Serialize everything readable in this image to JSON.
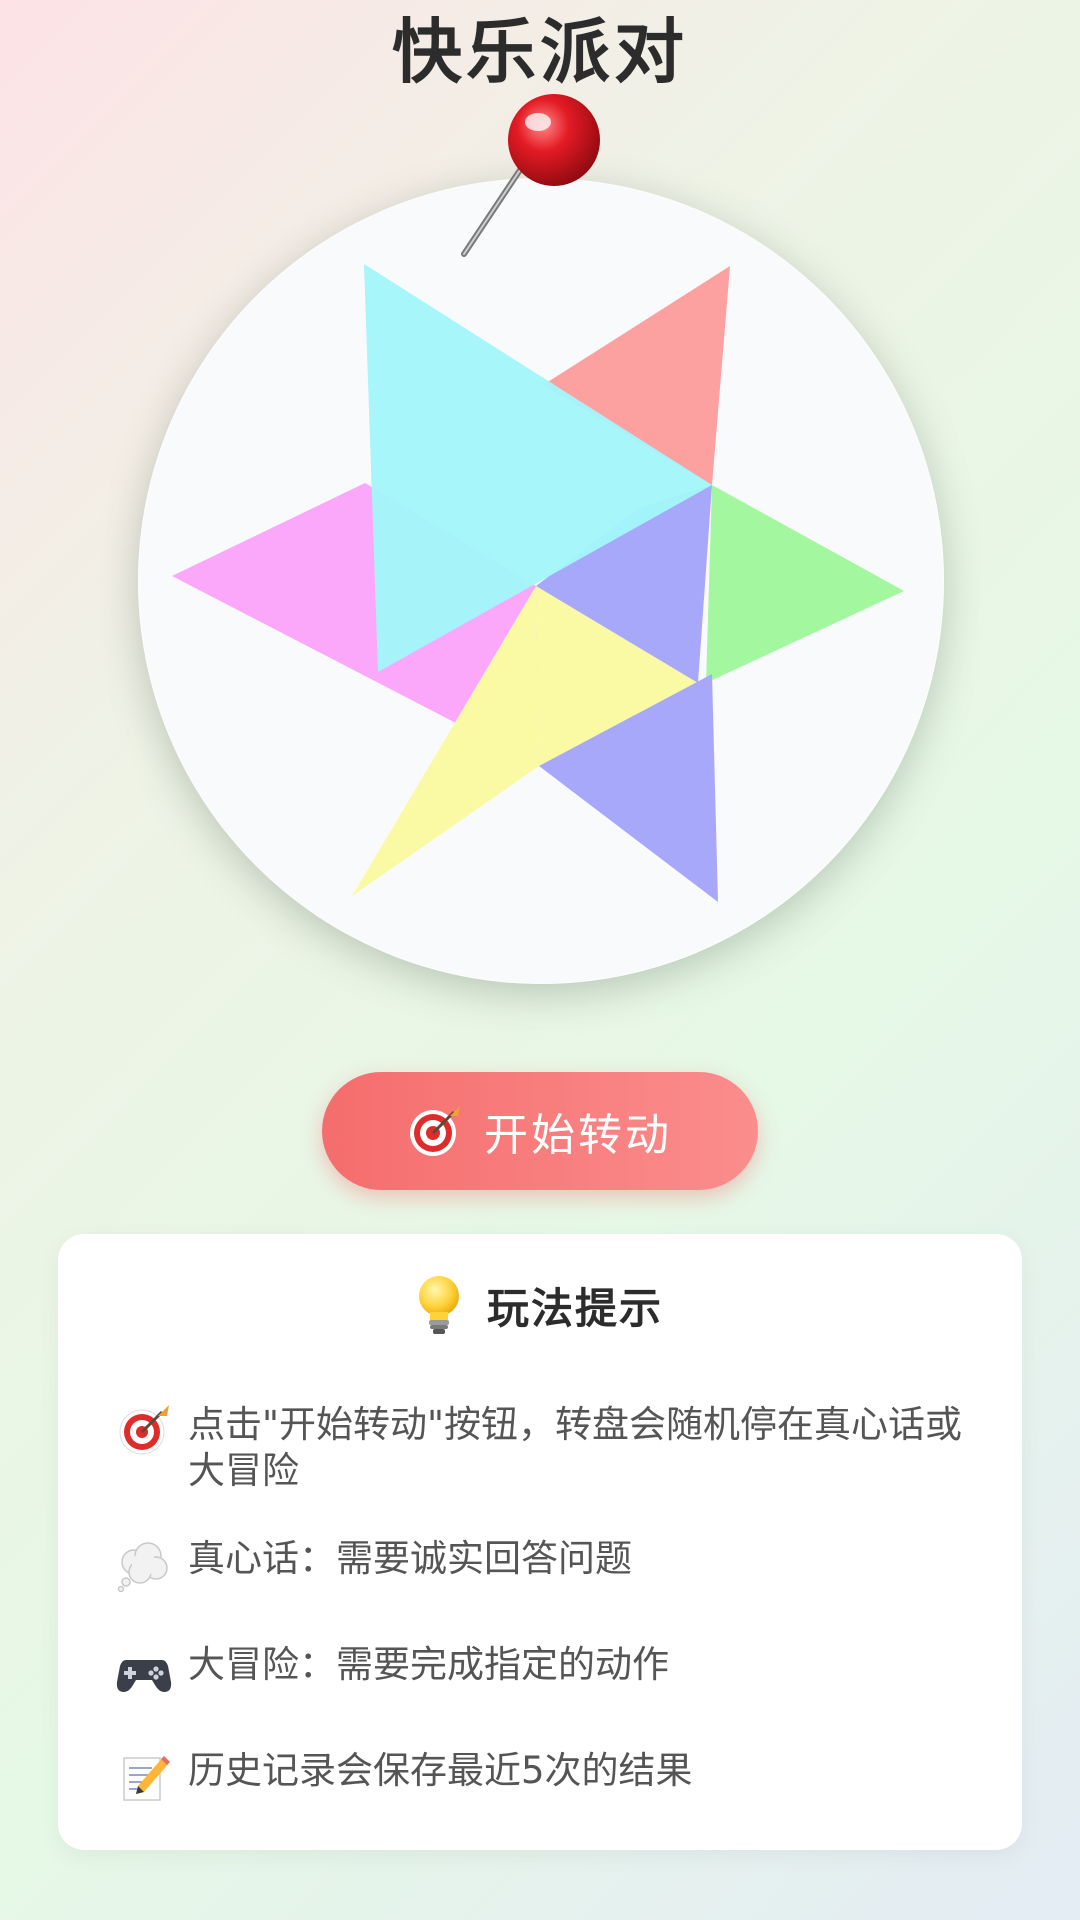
{
  "app": {
    "title": "快乐派对"
  },
  "wheel": {
    "colors": {
      "cyan": "#a2f6fa",
      "red": "#fda0a0",
      "green": "#a2f79f",
      "pink": "#fba6fb",
      "yellow": "#fbfaa4",
      "blue": "#a8a8fb",
      "pin_head": "#e01020"
    }
  },
  "spin_button": {
    "label": "开始转动",
    "icon": "target-dart-icon",
    "color_start": "#f56d6d",
    "color_end": "#fb8d8d"
  },
  "tips": {
    "title": "玩法提示",
    "icon": "light-bulb-icon",
    "items": [
      {
        "icon": "target-dart-icon",
        "text": "点击\"开始转动\"按钮，转盘会随机停在真心话或大冒险"
      },
      {
        "icon": "thought-bubble-icon",
        "text": "真心话：需要诚实回答问题"
      },
      {
        "icon": "gamepad-icon",
        "text": "大冒险：需要完成指定的动作"
      },
      {
        "icon": "memo-pencil-icon",
        "text": "历史记录会保存最近5次的结果"
      }
    ]
  }
}
